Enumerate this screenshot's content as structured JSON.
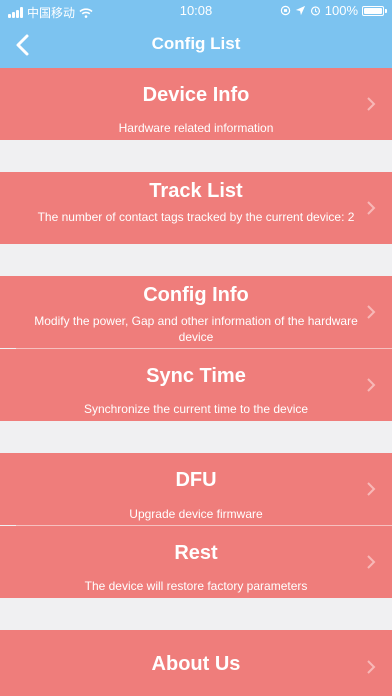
{
  "status": {
    "carrier": "中国移动",
    "time": "10:08",
    "battery": "100%"
  },
  "nav": {
    "title": "Config List",
    "back_icon": "chevron-left-icon"
  },
  "colors": {
    "nav_bg": "#7cc3f0",
    "row_bg": "#ef7d7b",
    "page_bg": "#f0f0f2",
    "text": "#ffffff"
  },
  "items": [
    {
      "title": "Device Info",
      "subtitle": "Hardware related information"
    },
    {
      "title": "Track List",
      "subtitle": "The number of contact tags tracked by the current device: 2"
    },
    {
      "title": "Config Info",
      "subtitle": "Modify the power, Gap and other information of the hardware device"
    },
    {
      "title": "Sync Time",
      "subtitle": "Synchronize the current time to the device"
    },
    {
      "title": "DFU",
      "subtitle": "Upgrade device firmware"
    },
    {
      "title": "Rest",
      "subtitle": "The device will restore factory parameters"
    },
    {
      "title": "About Us",
      "subtitle": ""
    }
  ]
}
